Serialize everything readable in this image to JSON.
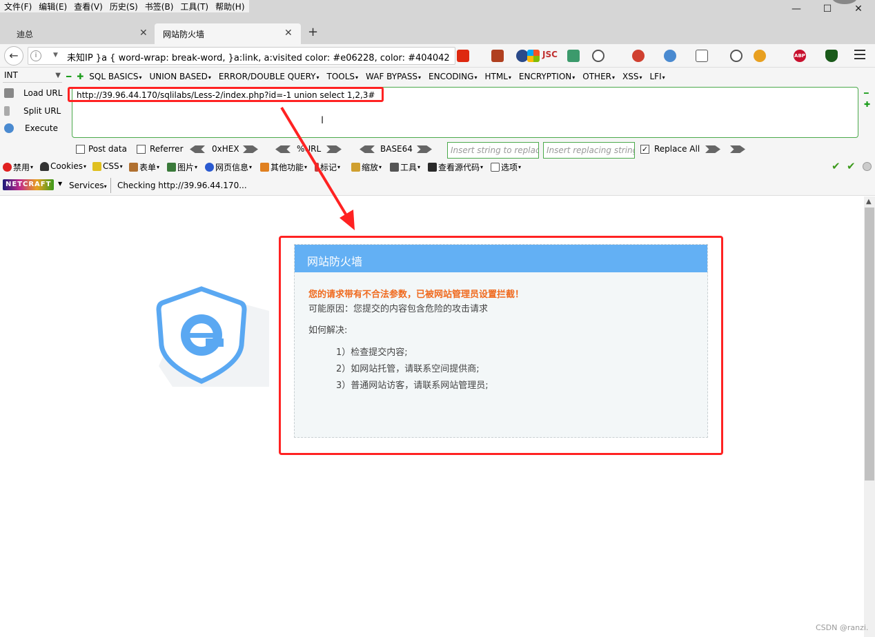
{
  "menubar": [
    "文件(F)",
    "编辑(E)",
    "查看(V)",
    "历史(S)",
    "书签(B)",
    "工具(T)",
    "帮助(H)"
  ],
  "window_controls": {
    "minimize": "—",
    "maximize": "☐",
    "close": "✕"
  },
  "tabs": [
    {
      "label": "迪总",
      "active": false
    },
    {
      "label": "网站防火墙",
      "active": true
    }
  ],
  "new_tab": "+",
  "nav": {
    "back": "←",
    "url_text": "未知IP   }a { word-wrap: break-word, }a:link, a:visited  color: #e06228, color: #404042"
  },
  "hackbar": {
    "type_select": "INT",
    "menu": [
      "SQL BASICS",
      "UNION BASED",
      "ERROR/DOUBLE QUERY",
      "TOOLS",
      "WAF BYPASS",
      "ENCODING",
      "HTML",
      "ENCRYPTION",
      "OTHER",
      "XSS",
      "LFI"
    ],
    "actions": {
      "load": "Load URL",
      "split": "Split URL",
      "execute": "Execute"
    },
    "url_value": "http://39.96.44.170/sqlilabs/Less-2/index.php?id=-1 union select 1,2,3#",
    "options": {
      "post_data": "Post data",
      "referrer": "Referrer",
      "hex": "0xHEX",
      "url_enc": "%URL",
      "base64": "BASE64",
      "replace_placeholder": "Insert string to replace",
      "replacing_placeholder": "Insert replacing string",
      "replace_all": "Replace All"
    }
  },
  "devbar": [
    "禁用",
    "Cookies",
    "CSS",
    "表单",
    "图片",
    "网页信息",
    "其他功能",
    "标记",
    "缩放",
    "工具",
    "查看源代码",
    "选项"
  ],
  "netcraft": {
    "logo": "NETCRAFT",
    "services": "Services",
    "status": "Checking http://39.96.44.170..."
  },
  "firewall": {
    "title": "网站防火墙",
    "warning": "您的请求带有不合法参数，已被网站管理员设置拦截！",
    "reason": "可能原因：您提交的内容包含危险的攻击请求",
    "how": "如何解决:",
    "steps": [
      "1）检查提交内容;",
      "2）如网站托管，请联系空间提供商;",
      "3）普通网站访客，请联系网站管理员;"
    ]
  },
  "watermark": "CSDN @ranzi.",
  "colors": {
    "accent_red": "#ff2222",
    "panel_header": "#63b0f4",
    "warning": "#f06a1e",
    "hackbar_green": "#4aa94a",
    "shield_blue": "#5aa8f2"
  }
}
